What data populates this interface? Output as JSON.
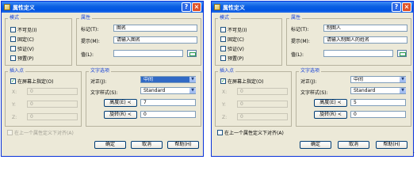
{
  "dialog_left": {
    "title": "属性定义",
    "mode": {
      "legend": "模式",
      "options": [
        {
          "label": "不可见(I)",
          "checked": false
        },
        {
          "label": "固定(C)",
          "checked": false
        },
        {
          "label": "验证(V)",
          "checked": false
        },
        {
          "label": "预置(P)",
          "checked": false
        }
      ]
    },
    "attribute": {
      "legend": "属性",
      "tag_label": "标记(T):",
      "tag_value": "图名",
      "prompt_label": "提示(M):",
      "prompt_value": "请输入图名",
      "value_label": "值(L):",
      "value_value": ""
    },
    "insertion": {
      "legend": "插入点",
      "on_screen_label": "在屏幕上指定(O)",
      "on_screen_checked": true,
      "x_label": "X:",
      "x_value": "0",
      "y_label": "Y:",
      "y_value": "0",
      "z_label": "Z:",
      "z_value": "0"
    },
    "text": {
      "legend": "文字选项",
      "justify_label": "对正(J):",
      "justify_value": "中间",
      "style_label": "文字样式(S):",
      "style_value": "Standard",
      "height_button": "高度(E) <",
      "height_value": "7",
      "rotation_button": "旋转(R) <",
      "rotation_value": "0"
    },
    "align_below_label": "在上一个属性定义下对齐(A)",
    "buttons": {
      "ok": "确定",
      "cancel": "取消",
      "help": "帮助(H)"
    }
  },
  "dialog_right": {
    "title": "属性定义",
    "mode": {
      "legend": "模式",
      "options": [
        {
          "label": "不可见(I)",
          "checked": false
        },
        {
          "label": "固定(C)",
          "checked": false
        },
        {
          "label": "验证(V)",
          "checked": false
        },
        {
          "label": "预置(P)",
          "checked": false
        }
      ]
    },
    "attribute": {
      "legend": "属性",
      "tag_label": "标记(T):",
      "tag_value": "制图人",
      "prompt_label": "提示(M):",
      "prompt_value": "请输入制图人的姓名",
      "value_label": "值(L):",
      "value_value": ""
    },
    "insertion": {
      "legend": "插入点",
      "on_screen_label": "在屏幕上指定(O)",
      "on_screen_checked": true,
      "x_label": "X:",
      "x_value": "0",
      "y_label": "Y:",
      "y_value": "0",
      "z_label": "Z:",
      "z_value": "0"
    },
    "text": {
      "legend": "文字选项",
      "justify_label": "对正(J):",
      "justify_value": "中间",
      "style_label": "文字样式(S):",
      "style_value": "Standard",
      "height_button": "高度(E) <",
      "height_value": "5",
      "rotation_button": "旋转(R) <",
      "rotation_value": "0"
    },
    "align_below_label": "在上一个属性定义下对齐(A)",
    "buttons": {
      "ok": "确定",
      "cancel": "取消",
      "help": "帮助(H)"
    }
  },
  "stray_mark": "."
}
